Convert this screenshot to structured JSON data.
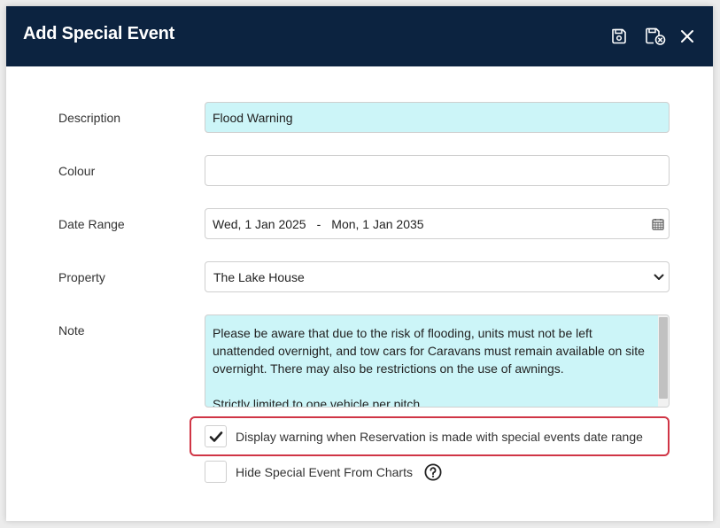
{
  "dialog": {
    "title": "Add Special Event",
    "header_buttons": [
      {
        "icon": "save-icon"
      },
      {
        "icon": "save-close-icon"
      },
      {
        "icon": "close-icon"
      }
    ],
    "header_color": "#0c2340"
  },
  "form": {
    "description": {
      "label": "Description",
      "value": "Flood Warning"
    },
    "colour": {
      "label": "Colour",
      "value": ""
    },
    "date_range": {
      "label": "Date Range",
      "start": "Wed, 1 Jan 2025",
      "separator": "-",
      "end": "Mon, 1 Jan 2035",
      "icon": "calendar-icon"
    },
    "property": {
      "label": "Property",
      "value": "The Lake House"
    },
    "note": {
      "label": "Note",
      "value": "Please be aware that due to the risk of flooding, units must not be left unattended overnight, and tow cars for Caravans must remain available on site overnight. There may also be restrictions on the use of awnings.\n\nStrictly limited to one vehicle per pitch."
    },
    "display_warning": {
      "label": "Display warning when Reservation is made with special events date range",
      "checked": true
    },
    "hide_from_charts": {
      "label": "Hide Special Event From Charts",
      "checked": false,
      "help_icon": "help-icon"
    }
  },
  "colors": {
    "filled_field": "#ccf5f8",
    "highlight": "#d03545"
  }
}
